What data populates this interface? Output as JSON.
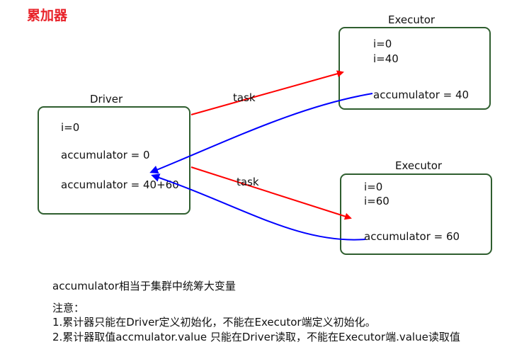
{
  "title": "累加器",
  "driver": {
    "label": "Driver",
    "line1": "i=0",
    "line2": "accumulator = 0",
    "line3": "accumulator = 40+60"
  },
  "executor_top": {
    "label": "Executor",
    "line1": "i=0",
    "line2": "i=40",
    "line3": "accumulator = 40"
  },
  "executor_bottom": {
    "label": "Executor",
    "line1": "i=0",
    "line2": "i=60",
    "line3": "accumulator = 60"
  },
  "arrows": {
    "task_top": "task",
    "task_bottom": "task",
    "task_color": "#ff0000",
    "return_color": "#0000ff"
  },
  "notes": {
    "summary": "accumulator相当于集群中统筹大变量",
    "heading": "注意：",
    "item1": "1.累计器只能在Driver定义初始化，不能在Executor端定义初始化。",
    "item2": "2.累计器取值accmulator.value  只能在Driver读取，不能在Executor端.value读取值"
  },
  "colors": {
    "title": "#e8232a",
    "box_border": "#2f5e2f"
  }
}
